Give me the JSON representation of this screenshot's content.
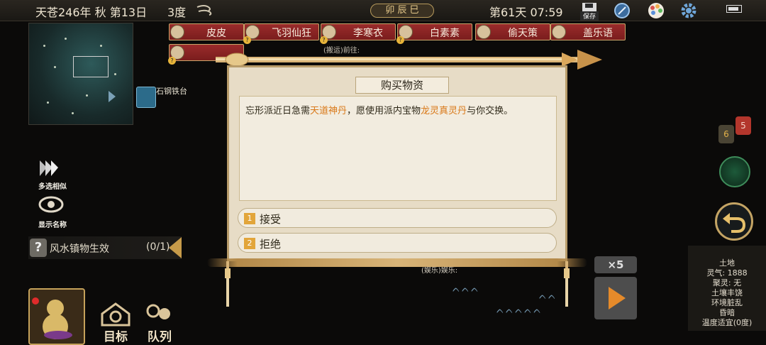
{
  "topbar": {
    "date": "天苍246年 秋 第13日",
    "temperature": "3度",
    "clock_label": "卯 辰 巳",
    "day_time": "第61天 07:59",
    "save_label": "保存"
  },
  "characters": [
    {
      "name": "皮皮"
    },
    {
      "name": "飞羽仙狂"
    },
    {
      "name": "李寒衣"
    },
    {
      "name": "白素素"
    },
    {
      "name": "偷天策"
    },
    {
      "name": "盖乐语"
    }
  ],
  "notes": {
    "move_to": "(搬运)前往:",
    "entertainment": "(娱乐)娱乐:",
    "bookstand": "石钢铁台"
  },
  "left_buttons": {
    "multi_select": "多选相似",
    "show_names": "显示名称"
  },
  "fengshui": {
    "label": "风水镇物生效",
    "count": "(0/1)"
  },
  "bottom": {
    "goal_label": "目标",
    "team_label": "队列"
  },
  "right": {
    "bubble_a": "6",
    "bubble_b": "5",
    "speed": "×5"
  },
  "tile_info": {
    "lines": [
      "土地",
      "灵气: 1888",
      "聚灵: 无",
      "土壤丰饶",
      "环境脏乱",
      "昏暗",
      "温度适宜(0度)"
    ]
  },
  "dialog": {
    "title": "购买物资",
    "text_prefix": "忘形派近日急需",
    "item_wanted": "天道神丹",
    "text_middle": "，愿使用派内宝物",
    "item_offered": "龙灵真灵丹",
    "text_suffix": "与你交换。",
    "options": [
      {
        "num": "1",
        "label": "接受"
      },
      {
        "num": "2",
        "label": "拒绝"
      }
    ]
  },
  "colors": {
    "accent": "#d97818",
    "tab_red": "#8b2323",
    "gold": "#c4a464"
  }
}
